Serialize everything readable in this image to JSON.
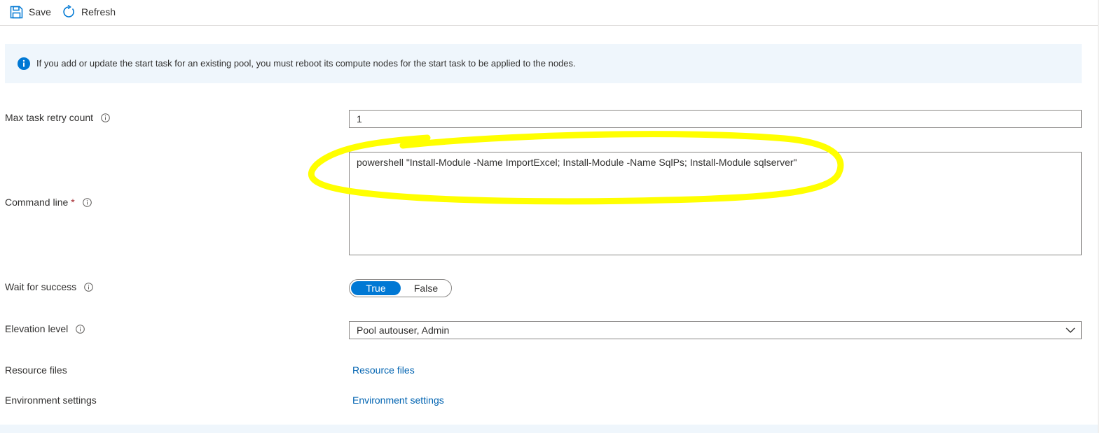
{
  "toolbar": {
    "save_label": "Save",
    "refresh_label": "Refresh"
  },
  "info": {
    "text": "If you add or update the start task for an existing pool, you must reboot its compute nodes for the start task to be applied to the nodes."
  },
  "form": {
    "retry": {
      "label": "Max task retry count",
      "value": "1"
    },
    "command": {
      "label": "Command line",
      "required_mark": "*",
      "value": "powershell \"Install-Module -Name ImportExcel; Install-Module -Name SqlPs; Install-Module sqlserver\""
    },
    "wait": {
      "label": "Wait for success",
      "options": [
        "True",
        "False"
      ],
      "selected": "True"
    },
    "elevation": {
      "label": "Elevation level",
      "value": "Pool autouser, Admin"
    },
    "resource_files": {
      "label": "Resource files",
      "link": "Resource files"
    },
    "environment": {
      "label": "Environment settings",
      "link": "Environment settings"
    }
  },
  "colors": {
    "accent": "#0078d4",
    "link": "#0063b1",
    "info_background": "#eff6fc",
    "highlight": "#ffff00",
    "required": "#a4262c"
  },
  "icons": [
    "save-icon",
    "refresh-icon",
    "info-icon",
    "info-hint-icon",
    "chevron-down-icon"
  ]
}
